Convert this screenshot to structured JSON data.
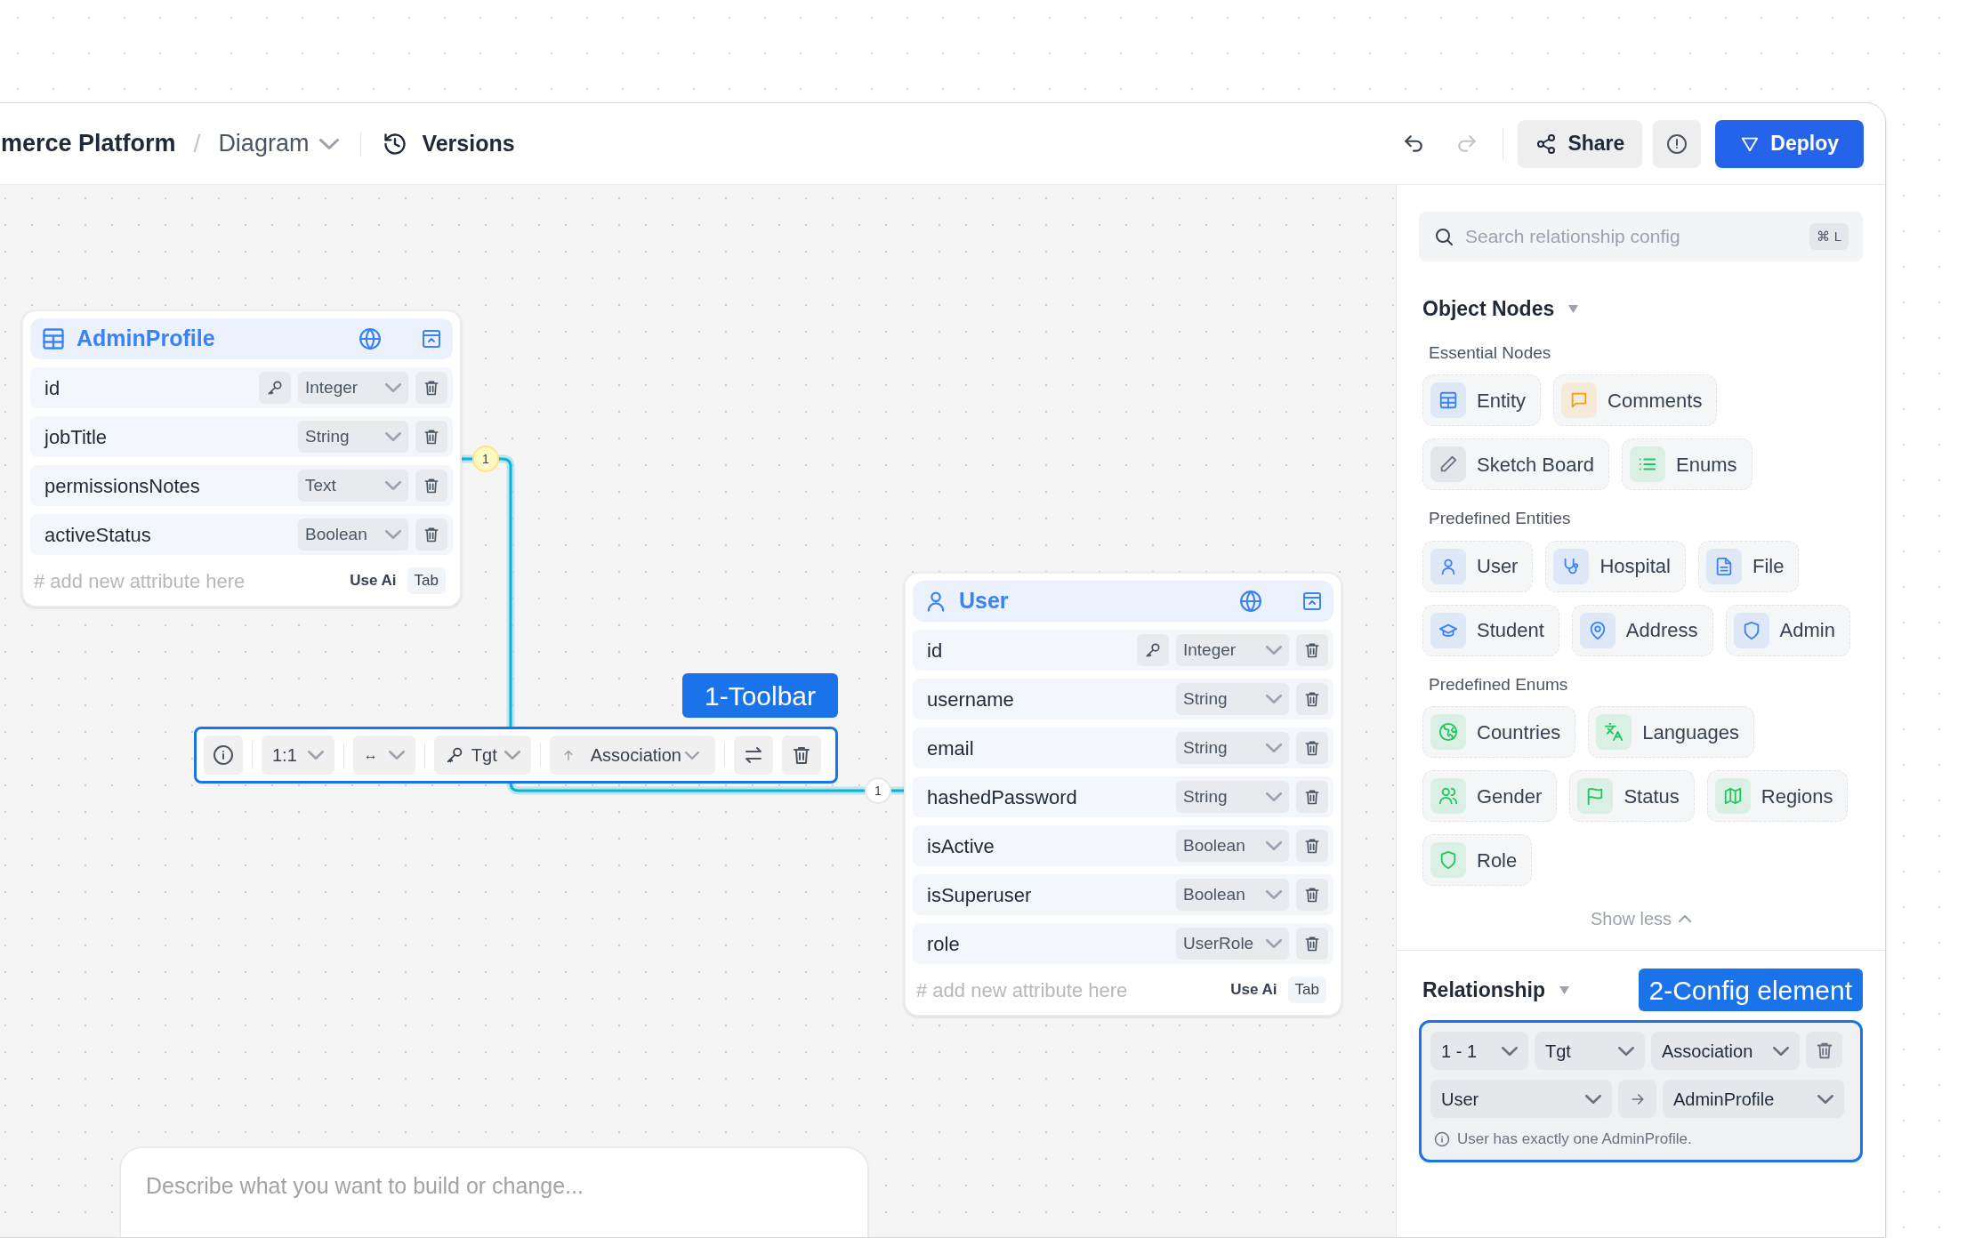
{
  "header": {
    "separator": "/",
    "breadcrumb": [
      {
        "label": "merce Platform"
      },
      {
        "label": "Diagram"
      }
    ],
    "versions": "Versions",
    "share": "Share",
    "deploy": "Deploy"
  },
  "canvas": {
    "entities": [
      {
        "name": "AdminProfile",
        "attributes": [
          {
            "name": "id",
            "type": "Integer",
            "primary_key": true
          },
          {
            "name": "jobTitle",
            "type": "String",
            "primary_key": false
          },
          {
            "name": "permissionsNotes",
            "type": "Text",
            "primary_key": false
          },
          {
            "name": "activeStatus",
            "type": "Boolean",
            "primary_key": false
          }
        ],
        "placeholder": "# add new attribute here",
        "use_ai": "Use Ai",
        "shortcut": "Tab"
      },
      {
        "name": "User",
        "attributes": [
          {
            "name": "id",
            "type": "Integer",
            "primary_key": true
          },
          {
            "name": "username",
            "type": "String",
            "primary_key": false
          },
          {
            "name": "email",
            "type": "String",
            "primary_key": false
          },
          {
            "name": "hashedPassword",
            "type": "String",
            "primary_key": false
          },
          {
            "name": "isActive",
            "type": "Boolean",
            "primary_key": false
          },
          {
            "name": "isSuperuser",
            "type": "Boolean",
            "primary_key": false
          },
          {
            "name": "role",
            "type": "UserRole",
            "primary_key": false
          }
        ],
        "placeholder": "# add new attribute here",
        "use_ai": "Use Ai",
        "shortcut": "Tab"
      }
    ],
    "edge": {
      "source_badge": "1",
      "target_badge": "1"
    },
    "toolbar": {
      "callout": "1-Toolbar",
      "cardinality": "1:1",
      "direction": "↔",
      "end": "Tgt",
      "type": "Association"
    },
    "prompt": {
      "placeholder": "Describe what you want to build or change..."
    }
  },
  "sidebar": {
    "search": {
      "placeholder": "Search relationship config",
      "shortcut": "⌘ L"
    },
    "object_nodes": {
      "title": "Object Nodes",
      "groups": [
        {
          "title": "Essential Nodes",
          "items": [
            {
              "label": "Entity",
              "color": "#3b82f6"
            },
            {
              "label": "Comments",
              "color": "#f59e0b"
            },
            {
              "label": "Sketch Board",
              "color": "#6b7280"
            },
            {
              "label": "Enums",
              "color": "#22c55e"
            }
          ]
        },
        {
          "title": "Predefined Entities",
          "items": [
            {
              "label": "User",
              "color": "#3b82f6"
            },
            {
              "label": "Hospital",
              "color": "#3b82f6"
            },
            {
              "label": "File",
              "color": "#3b82f6"
            },
            {
              "label": "Student",
              "color": "#3b82f6"
            },
            {
              "label": "Address",
              "color": "#3b82f6"
            },
            {
              "label": "Admin",
              "color": "#3b82f6"
            }
          ]
        },
        {
          "title": "Predefined Enums",
          "items": [
            {
              "label": "Countries",
              "color": "#22c55e"
            },
            {
              "label": "Languages",
              "color": "#22c55e"
            },
            {
              "label": "Gender",
              "color": "#22c55e"
            },
            {
              "label": "Status",
              "color": "#22c55e"
            },
            {
              "label": "Regions",
              "color": "#22c55e"
            },
            {
              "label": "Role",
              "color": "#22c55e"
            }
          ]
        }
      ],
      "show_less": "Show less"
    },
    "relationship": {
      "title": "Relationship",
      "callout": "2-Config element",
      "cardinality": "1 - 1",
      "end": "Tgt",
      "type": "Association",
      "source": "User",
      "target": "AdminProfile",
      "note": "User has exactly one AdminProfile."
    }
  }
}
